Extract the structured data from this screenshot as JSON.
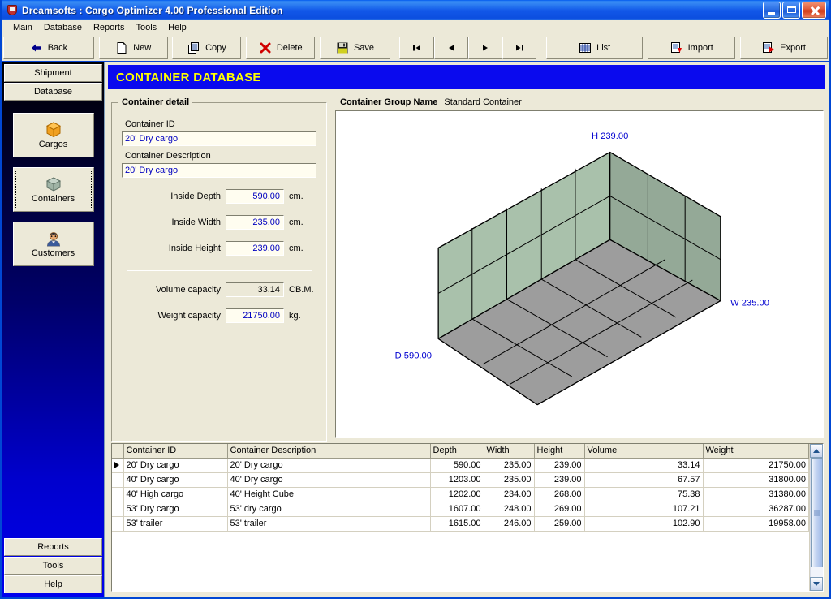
{
  "window": {
    "title": "Dreamsofts : Cargo Optimizer 4.00 Professional Edition",
    "app_icon": "shield-icon",
    "minimize_label": "Minimize",
    "maximize_label": "Maximize",
    "close_label": "Close"
  },
  "menubar": {
    "items": [
      {
        "label": "Main"
      },
      {
        "label": "Database"
      },
      {
        "label": "Reports"
      },
      {
        "label": "Tools"
      },
      {
        "label": "Help"
      }
    ]
  },
  "toolbar": {
    "buttons": [
      {
        "label": "Back",
        "icon": "back-arrow-icon"
      },
      {
        "label": "New",
        "icon": "new-page-icon"
      },
      {
        "label": "Copy",
        "icon": "copy-pages-icon"
      },
      {
        "label": "Delete",
        "icon": "red-x-icon"
      },
      {
        "label": "Save",
        "icon": "floppy-disk-icon"
      }
    ],
    "nav": [
      {
        "label": "First",
        "icon": "nav-first-icon"
      },
      {
        "label": "Previous",
        "icon": "nav-prev-icon"
      },
      {
        "label": "Next",
        "icon": "nav-next-icon"
      },
      {
        "label": "Last",
        "icon": "nav-last-icon"
      }
    ],
    "right": [
      {
        "label": "List",
        "icon": "list-grid-icon"
      },
      {
        "label": "Import",
        "icon": "import-icon"
      },
      {
        "label": "Export",
        "icon": "export-icon"
      }
    ]
  },
  "sidebar": {
    "top_buttons": [
      {
        "label": "Shipment"
      },
      {
        "label": "Database"
      }
    ],
    "nav_items": [
      {
        "label": "Cargos",
        "icon": "orange-cube-icon",
        "selected": false
      },
      {
        "label": "Containers",
        "icon": "gray-cube-icon",
        "selected": true
      },
      {
        "label": "Customers",
        "icon": "person-icon",
        "selected": false
      }
    ],
    "bottom_buttons": [
      {
        "label": "Reports"
      },
      {
        "label": "Tools"
      },
      {
        "label": "Help"
      }
    ]
  },
  "page": {
    "title": "CONTAINER DATABASE",
    "title_bg": "#0a0aee",
    "title_fg": "#ffff00"
  },
  "detail": {
    "group_title": "Container detail",
    "container_id_label": "Container ID",
    "container_id_value": "20' Dry cargo",
    "container_desc_label": "Container Description",
    "container_desc_value": "20' Dry cargo",
    "fields": [
      {
        "label": "Inside Depth",
        "value": "590.00",
        "unit": "cm.",
        "readonly": false
      },
      {
        "label": "Inside Width",
        "value": "235.00",
        "unit": "cm.",
        "readonly": false
      },
      {
        "label": "Inside Height",
        "value": "239.00",
        "unit": "cm.",
        "readonly": false
      }
    ],
    "capacity": [
      {
        "label": "Volume capacity",
        "value": "33.14",
        "unit": "CB.M.",
        "readonly": true
      },
      {
        "label": "Weight capacity",
        "value": "21750.00",
        "unit": "kg.",
        "readonly": false
      }
    ]
  },
  "visual": {
    "group_name_label": "Container Group Name",
    "group_name_value": "Standard Container",
    "labels": {
      "height": "H 239.00",
      "width": "W 235.00",
      "depth": "D 590.00"
    },
    "colors": {
      "wall": "#a8bfa8",
      "wall_dark": "#94a694",
      "floor": "#9e9e9e",
      "edge": "#000000",
      "dim_text": "#0000d0"
    }
  },
  "grid": {
    "columns": [
      {
        "label": "Container ID",
        "align": "left"
      },
      {
        "label": "Container Description",
        "align": "left"
      },
      {
        "label": "Depth",
        "align": "right"
      },
      {
        "label": "Width",
        "align": "right"
      },
      {
        "label": "Height",
        "align": "right"
      },
      {
        "label": "Volume",
        "align": "right"
      },
      {
        "label": "Weight",
        "align": "right"
      }
    ],
    "rows": [
      {
        "selected": true,
        "cells": [
          "20' Dry cargo",
          "20' Dry cargo",
          "590.00",
          "235.00",
          "239.00",
          "33.14",
          "21750.00"
        ]
      },
      {
        "selected": false,
        "cells": [
          "40' Dry cargo",
          "40' Dry cargo",
          "1203.00",
          "235.00",
          "239.00",
          "67.57",
          "31800.00"
        ]
      },
      {
        "selected": false,
        "cells": [
          "40' High cargo",
          "40' Height Cube",
          "1202.00",
          "234.00",
          "268.00",
          "75.38",
          "31380.00"
        ]
      },
      {
        "selected": false,
        "cells": [
          "53' Dry cargo",
          "53' dry cargo",
          "1607.00",
          "248.00",
          "269.00",
          "107.21",
          "36287.00"
        ]
      },
      {
        "selected": false,
        "cells": [
          "53' trailer",
          "53' trailer",
          "1615.00",
          "246.00",
          "259.00",
          "102.90",
          "19958.00"
        ]
      }
    ]
  }
}
